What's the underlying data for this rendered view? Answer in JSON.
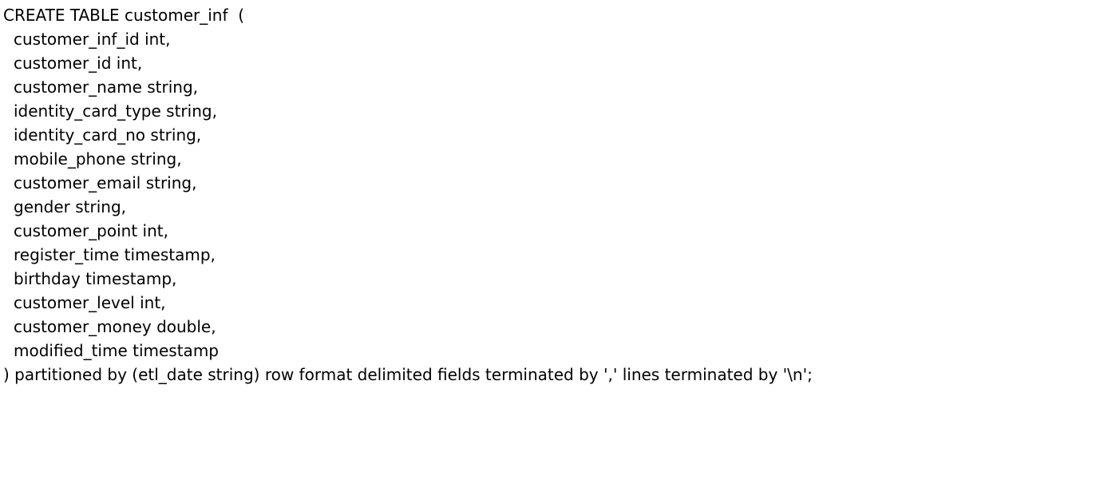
{
  "document": {
    "header_line": "CREATE TABLE customer_inf  (",
    "columns": [
      "customer_inf_id int,",
      "customer_id int,",
      "customer_name string,",
      "identity_card_type string,",
      "identity_card_no string,",
      "mobile_phone string,",
      "customer_email string,",
      "gender string,",
      "customer_point int,",
      "register_time timestamp,",
      "birthday timestamp,",
      "customer_level int,",
      "customer_money double,",
      "modified_time timestamp"
    ],
    "footer_line": ") partitioned by (etl_date string) row format delimited fields terminated by ',' lines terminated by '\\n';"
  }
}
